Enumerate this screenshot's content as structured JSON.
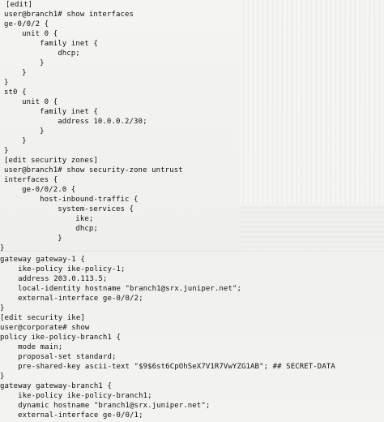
{
  "lines": [
    "[edit]",
    "user@branch1# show interfaces",
    "ge-0/0/2 {",
    "    unit 0 {",
    "        family inet {",
    "            dhcp;",
    "        }",
    "    }",
    "}",
    "st0 {",
    "    unit 0 {",
    "        family inet {",
    "            address 10.0.0.2/30;",
    "        }",
    "    }",
    "}",
    "[edit security zones]",
    "user@branch1# show security-zone untrust",
    "interfaces {",
    "    ge-0/0/2.0 {",
    "        host-inbound-traffic {",
    "            system-services {",
    "                ike;",
    "                dhcp;",
    "            }",
    "}",
    "gateway gateway-1 {",
    "    ike-policy ike-policy-1;",
    "    address 203.0.113.5;",
    "    local-identity hostname \"branch1@srx.juniper.net\";",
    "    external-interface ge-0/0/2;",
    "}",
    "[edit security ike]",
    "user@corporate# show",
    "policy ike-policy-branch1 {",
    "    mode main;",
    "    proposal-set standard;",
    "    pre-shared-key ascii-text \"$9$6st6CpOhSeX7V1R7VwYZG1AB\"; ## SECRET-DATA",
    "}",
    "gateway gateway-branch1 {",
    "    ike-policy ike-policy-branch1;",
    "    dynamic hostname \"branch1@srx.juniper.net\";",
    "    external-interface ge-0/0/1;"
  ]
}
